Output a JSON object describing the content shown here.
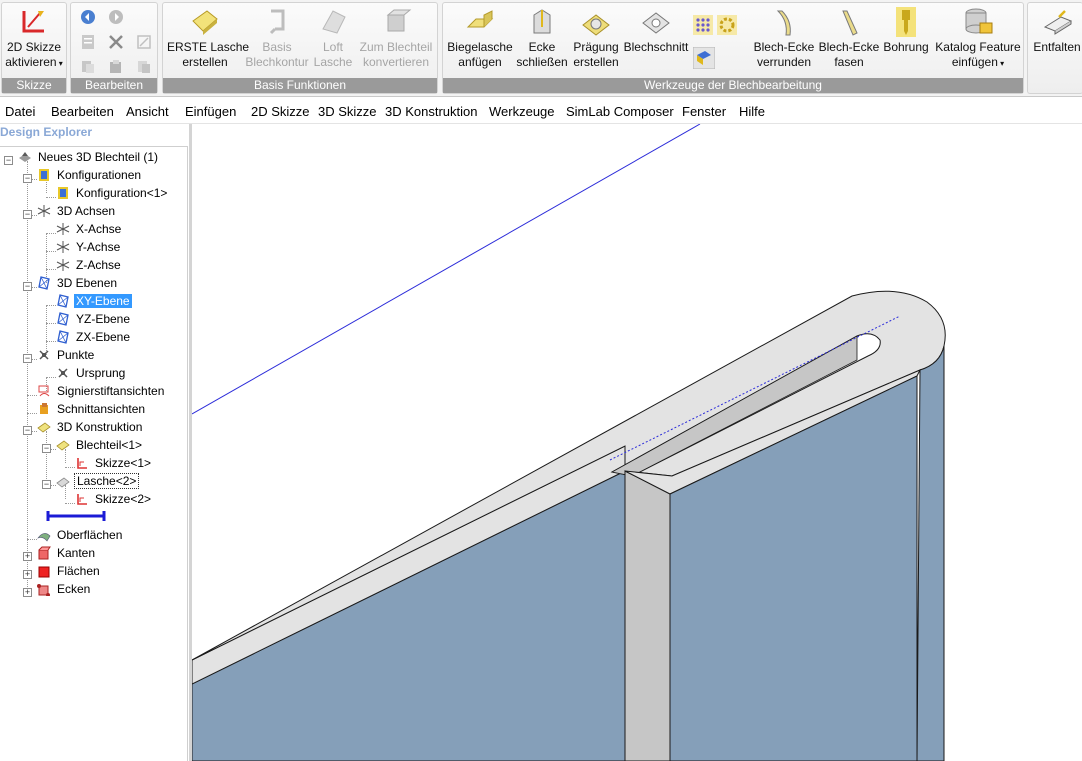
{
  "ribbon": {
    "groups": {
      "skizze": {
        "label": "Skizze",
        "btn_2d_skizze": "2D Skizze",
        "btn_2d_skizze_2": "aktivieren"
      },
      "bearbeiten": {
        "label": "Bearbeiten"
      },
      "basis": {
        "label": "Basis Funktionen",
        "erste_lasche_1": "ERSTE Lasche",
        "erste_lasche_2": "erstellen",
        "basis_kontur_1": "Basis",
        "basis_kontur_2": "Blechkontur",
        "loft_1": "Loft",
        "loft_2": "Lasche",
        "zum_blech_1": "Zum Blechteil",
        "zum_blech_2": "konvertieren"
      },
      "werkzeuge": {
        "label": "Werkzeuge der Blechbearbeitung",
        "biegelasche_1": "Biegelasche",
        "biegelasche_2": "anfügen",
        "ecke_1": "Ecke",
        "ecke_2": "schließen",
        "praegung_1": "Prägung",
        "praegung_2": "erstellen",
        "blechschnitt": "Blechschnitt",
        "verrunden_1": "Blech-Ecke",
        "verrunden_2": "verrunden",
        "fasen_1": "Blech-Ecke",
        "fasen_2": "fasen",
        "bohrung": "Bohrung",
        "katalog_1": "Katalog Feature",
        "katalog_2": "einfügen"
      },
      "entfalten": {
        "label": "Entfalten"
      }
    }
  },
  "menu": [
    "Datei",
    "Bearbeiten",
    "Ansicht",
    "Einfügen",
    "2D Skizze",
    "3D Skizze",
    "3D Konstruktion",
    "Werkzeuge",
    "SimLab Composer",
    "Fenster",
    "Hilfe"
  ],
  "explorer": {
    "title": "Design Explorer",
    "nodes": [
      "Neues 3D Blechteil (1)",
      "Konfigurationen",
      "Konfiguration<1>",
      "3D Achsen",
      "X-Achse",
      "Y-Achse",
      "Z-Achse",
      "3D Ebenen",
      "XY-Ebene",
      "YZ-Ebene",
      "ZX-Ebene",
      "Punkte",
      "Ursprung",
      "Signierstiftansichten",
      "Schnittansichten",
      "3D Konstruktion",
      "Blechteil<1>",
      "Skizze<1>",
      "Lasche<2>",
      "Skizze<2>",
      "Oberflächen",
      "Kanten",
      "Flächen",
      "Ecken"
    ]
  },
  "colors": {
    "face_blue": "#859fb9",
    "face_top": "#e3e3e3",
    "face_side": "#c6c6c6",
    "selection": "#3399ff",
    "group_label_bg": "#9a9a9a"
  }
}
